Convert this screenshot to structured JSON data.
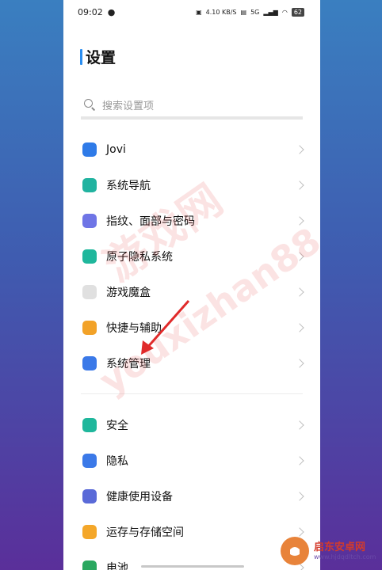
{
  "status": {
    "time": "09:02",
    "network": "4.10 KB/S",
    "signal": "5G",
    "battery": "62"
  },
  "title": "设置",
  "search": {
    "placeholder": "搜索设置项"
  },
  "group1": [
    {
      "label": "Jovi",
      "icon": "jovi-icon",
      "color": "#2f7be8"
    },
    {
      "label": "系统导航",
      "icon": "phone-nav-icon",
      "color": "#21b3a0"
    },
    {
      "label": "指纹、面部与密码",
      "icon": "fingerprint-icon",
      "color": "#6f75e6"
    },
    {
      "label": "原子隐私系统",
      "icon": "privacy-shield-icon",
      "color": "#1fb79c"
    },
    {
      "label": "游戏魔盒",
      "icon": "gamepad-icon",
      "color": "#e0e0e0"
    },
    {
      "label": "快捷与辅助",
      "icon": "shortcut-arrow-icon",
      "color": "#f2a228"
    },
    {
      "label": "系统管理",
      "icon": "system-hexagon-icon",
      "color": "#3b79e8"
    }
  ],
  "group2": [
    {
      "label": "安全",
      "icon": "security-shield-icon",
      "color": "#1fb79c"
    },
    {
      "label": "隐私",
      "icon": "lock-icon",
      "color": "#3b79e8"
    },
    {
      "label": "健康使用设备",
      "icon": "health-device-icon",
      "color": "#5a6ad8"
    },
    {
      "label": "运存与存储空间",
      "icon": "storage-pie-icon",
      "color": "#f4a72a"
    },
    {
      "label": "电池",
      "icon": "battery-icon",
      "color": "#2aa860"
    }
  ],
  "logo": {
    "name": "启东安卓网",
    "url": "www.hjdqdltch.com"
  }
}
